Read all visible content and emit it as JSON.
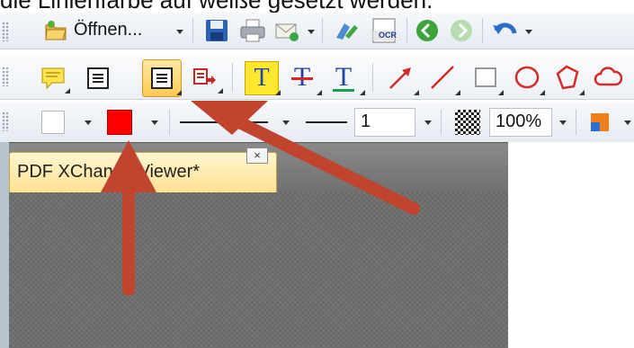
{
  "caption": {
    "text": "die Linienfarbe auf weiße gesetzt werden."
  },
  "toolbar1": {
    "open_label": "Öffnen...",
    "icons": [
      "open-folder-icon",
      "save-disk-icon",
      "print-icon",
      "email-icon",
      "scan-icon",
      "ocr-icon",
      "back-icon",
      "forward-icon",
      "undo-icon"
    ],
    "ocr_text": "OCR"
  },
  "toolbar2": {
    "tools": [
      "sticky-note",
      "text-box",
      "callout",
      "typewriter",
      "highlight",
      "strikeout",
      "underline",
      "arrow",
      "line",
      "rectangle",
      "oval",
      "polygon"
    ],
    "highlight_glyph": "T",
    "strikeout_glyph": "T",
    "underline_glyph": "T"
  },
  "toolbar3": {
    "fill_color": "#ffffff",
    "line_color": "#ff0000",
    "line_width_value": "1",
    "opacity_value": "100%",
    "extra_color": "#f07f1a"
  },
  "document": {
    "tab_title": "PDF XChange Viewer*",
    "tab_close_glyph": "×"
  },
  "colors": {
    "arrow": "#c0442e",
    "tab_fill": "#ffe293",
    "doc_background": "#6f6f6f"
  }
}
